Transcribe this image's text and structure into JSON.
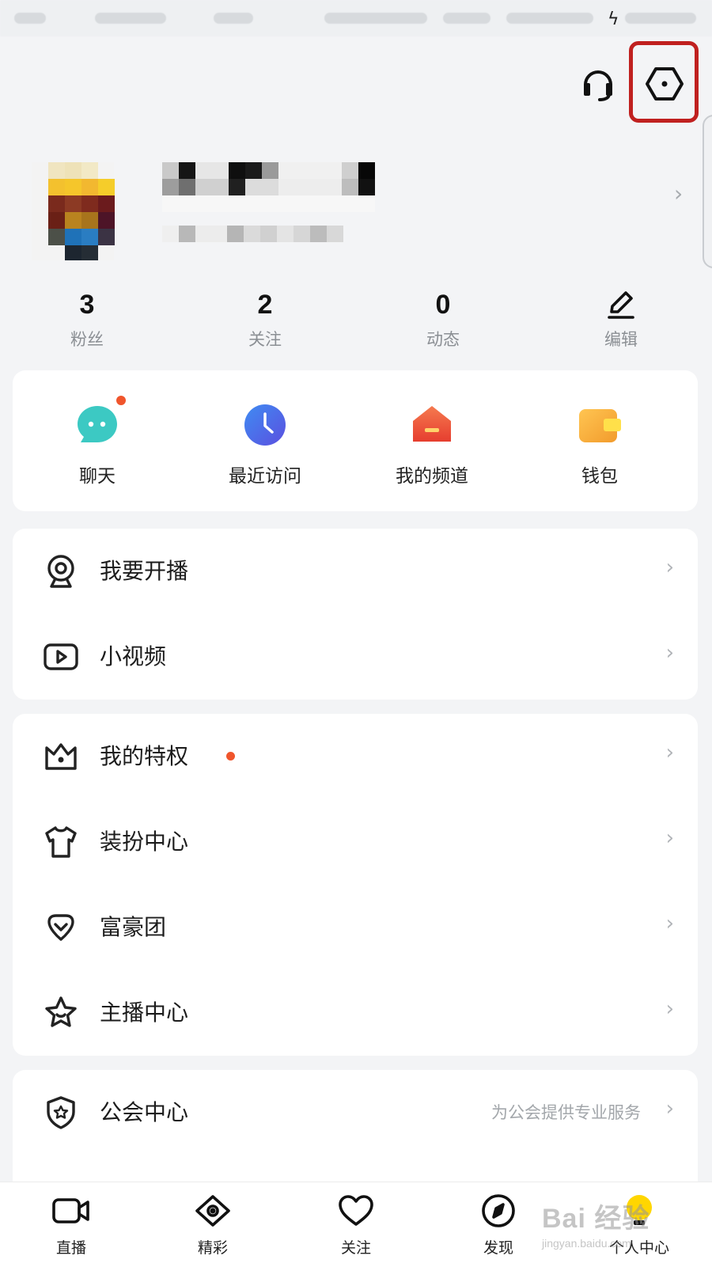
{
  "stats": {
    "fans": {
      "value": "3",
      "label": "粉丝"
    },
    "following": {
      "value": "2",
      "label": "关注"
    },
    "posts": {
      "value": "0",
      "label": "动态"
    },
    "edit": {
      "label": "编辑"
    }
  },
  "shortcuts": [
    {
      "label": "聊天",
      "icon": "chat-icon"
    },
    {
      "label": "最近访问",
      "icon": "clock-icon"
    },
    {
      "label": "我的频道",
      "icon": "house-icon"
    },
    {
      "label": "钱包",
      "icon": "wallet-icon"
    }
  ],
  "menu_group_1": [
    {
      "label": "我要开播",
      "icon": "webcam-icon"
    },
    {
      "label": "小视频",
      "icon": "play-icon"
    }
  ],
  "menu_group_2": [
    {
      "label": "我的特权",
      "icon": "crown-icon",
      "badge_dot": true
    },
    {
      "label": "装扮中心",
      "icon": "shirt-icon"
    },
    {
      "label": "富豪团",
      "icon": "diamond-icon"
    },
    {
      "label": "主播中心",
      "icon": "star-icon"
    }
  ],
  "menu_group_3": [
    {
      "label": "公会中心",
      "icon": "shield-icon",
      "description": "为公会提供专业服务"
    }
  ],
  "bottom_nav": [
    {
      "label": "直播",
      "icon": "video-camera-icon"
    },
    {
      "label": "精彩",
      "icon": "eye-icon"
    },
    {
      "label": "关注",
      "icon": "heart-icon"
    },
    {
      "label": "发现",
      "icon": "compass-icon"
    },
    {
      "label": "个人中心",
      "icon": "bulb-icon",
      "active": true
    }
  ],
  "watermark": {
    "brand": "Bai 经验",
    "url": "jingyan.baidu.com"
  },
  "colors": {
    "accent_red": "#f0552c",
    "highlight_box": "#c0201f",
    "chat": "#3cc9c3",
    "clock": "#4a6bea",
    "house": "#f05a3a",
    "wallet": "#f6b03a"
  }
}
